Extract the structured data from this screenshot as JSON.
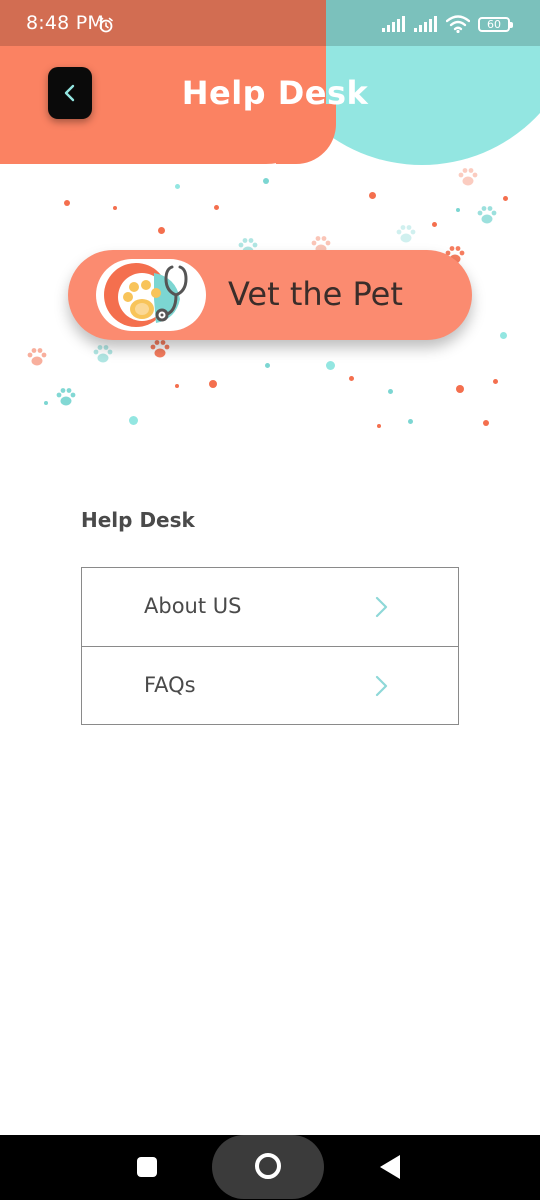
{
  "status_bar": {
    "time": "8:48 PM",
    "battery_level": "60",
    "icons": [
      "alarm-icon",
      "signal-icon",
      "signal-icon",
      "wifi-icon",
      "battery-icon"
    ]
  },
  "app_bar": {
    "title": "Help Desk",
    "back_icon": "chevron-left-icon"
  },
  "logo": {
    "text": "Vet the Pet",
    "icon": "paw-stethoscope-logo"
  },
  "help_desk": {
    "section_title": "Help Desk",
    "items": [
      {
        "label": "About US",
        "icon": "chevron-right-icon"
      },
      {
        "label": "FAQs",
        "icon": "chevron-right-icon"
      }
    ]
  },
  "nav_bar": {
    "buttons": [
      "recents-button",
      "home-button",
      "back-button"
    ]
  },
  "colors": {
    "accent_orange": "#FB8262",
    "accent_teal": "#93E6E1",
    "chevron": "#8ED8D8",
    "text": "#4a4a4a"
  }
}
